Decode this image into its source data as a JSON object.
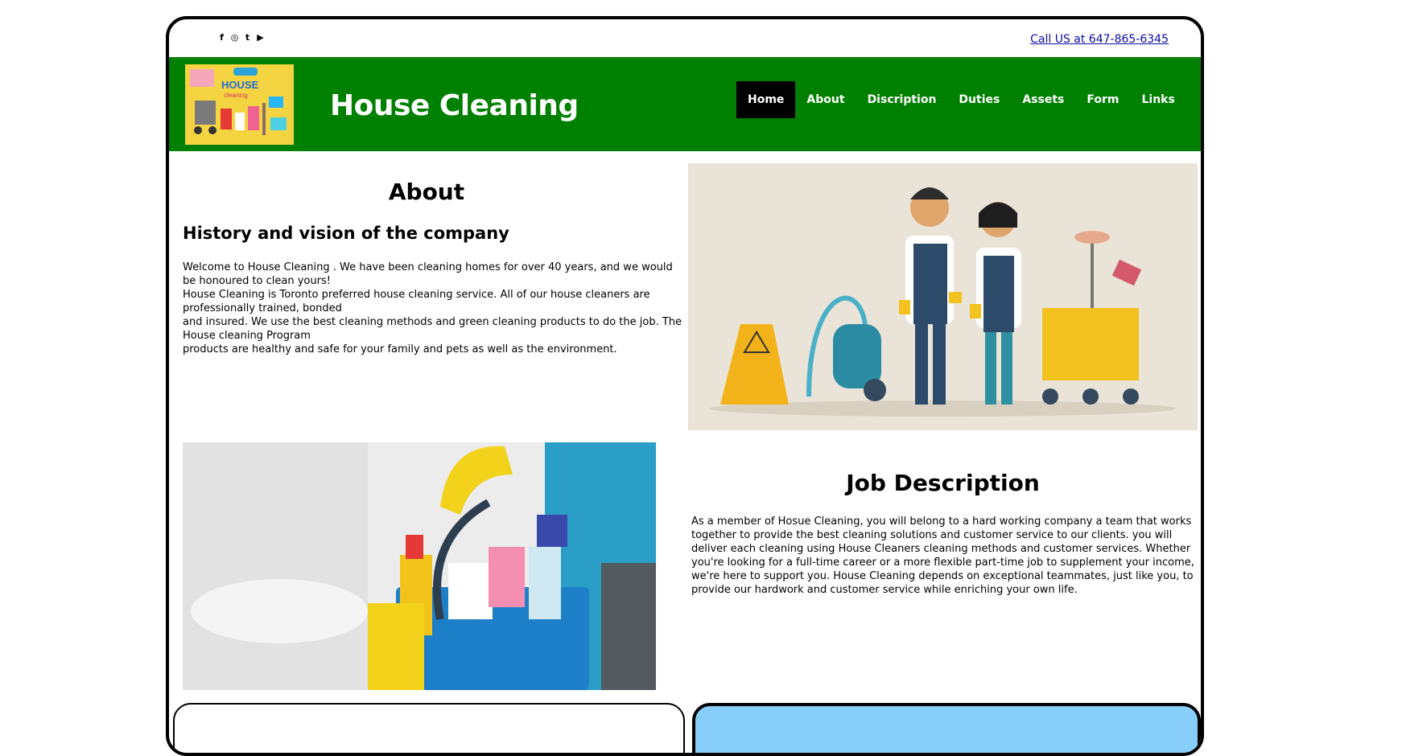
{
  "social": {
    "icons": [
      "facebook-icon",
      "instagram-icon",
      "twitter-icon",
      "youtube-icon"
    ],
    "glyphs": [
      "f",
      "◎",
      "t",
      "▶"
    ]
  },
  "header": {
    "call_link": "Call US at 647-865-6345",
    "site_title": "House Cleaning",
    "logo_text_1": "HOUSE",
    "logo_text_2": "cleaning",
    "bg_color": "#008000"
  },
  "nav": {
    "items": [
      {
        "label": "Home",
        "active": true
      },
      {
        "label": "About",
        "active": false
      },
      {
        "label": "Discription",
        "active": false
      },
      {
        "label": "Duties",
        "active": false
      },
      {
        "label": "Assets",
        "active": false
      },
      {
        "label": "Form",
        "active": false
      },
      {
        "label": "Links",
        "active": false
      }
    ]
  },
  "about": {
    "heading": "About",
    "subheading": "History and vision of the company",
    "paragraphs": [
      "Welcome to House Cleaning . We have been cleaning homes for over 40 years, and we would be honoured to clean yours!",
      "House Cleaning is Toronto preferred house cleaning service. All of our house cleaners are professionally trained, bonded",
      "and insured. We use the best cleaning methods and green cleaning products to do the job. The House cleaning Program",
      "products are healthy and safe for your family and pets as well as the environment."
    ]
  },
  "job": {
    "heading": "Job Description",
    "text": "As a member of Hosue Cleaning, you will belong to a hard working company a team that works together to provide the best cleaning solutions and customer service to our clients. you will deliver each cleaning using House Cleaners cleaning methods and customer services. Whether you're looking for a full-time career or a more flexible part-time job to supplement your income, we're here to support you. House Cleaning depends on exceptional teammates, just like you, to provide our hardwork and customer service while enriching your own life."
  },
  "cards": {
    "right_bg": "#87cefa"
  }
}
